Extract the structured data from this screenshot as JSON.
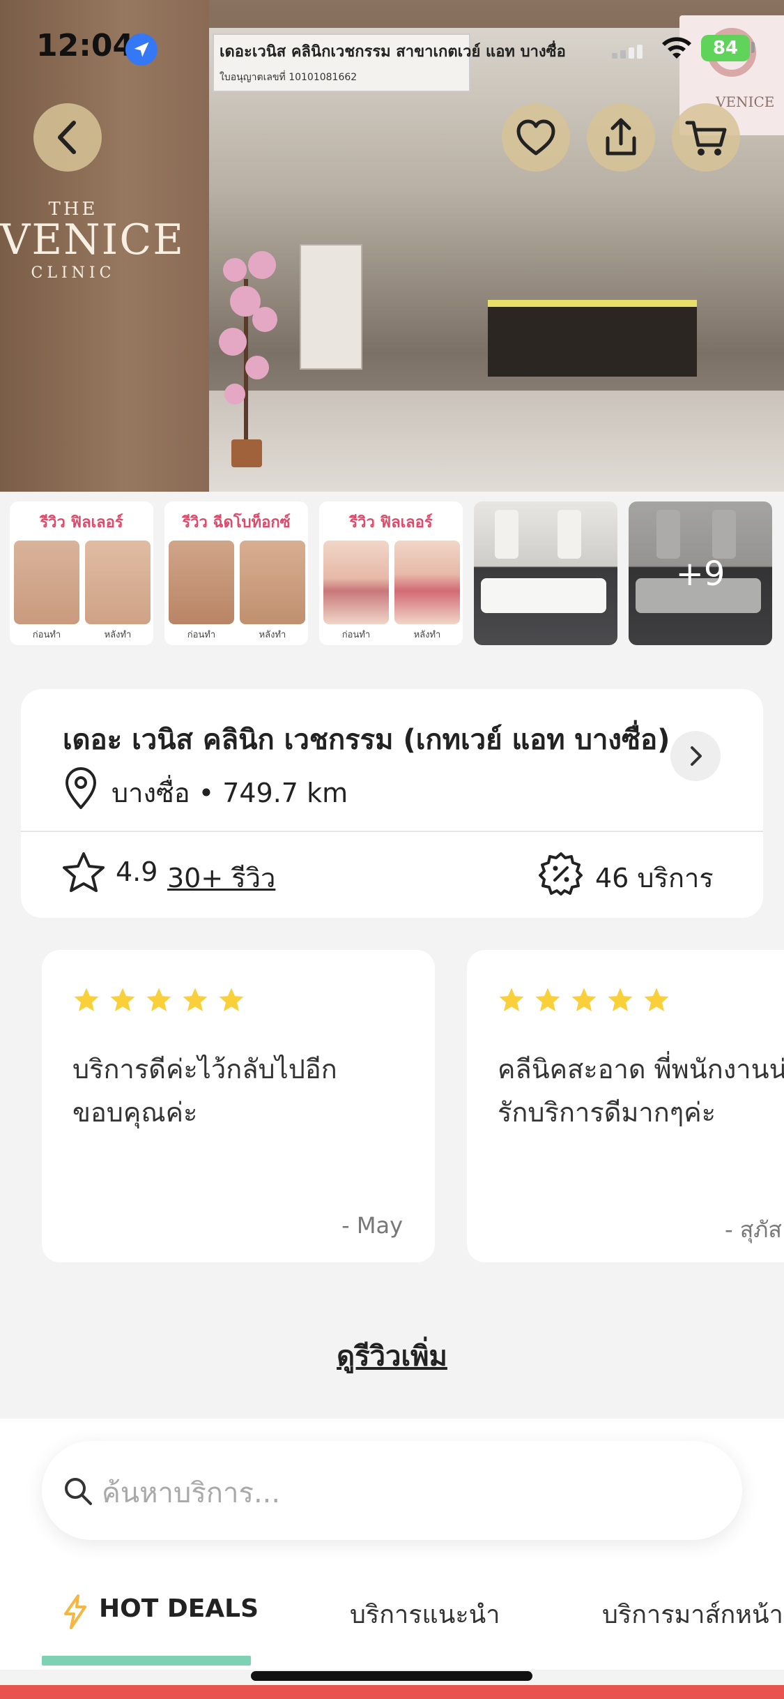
{
  "status_bar": {
    "time": "12:04",
    "battery": "84"
  },
  "hero": {
    "sign_title": "เดอะเวนิส คลินิกเวชกรรม สาขาเกตเวย์ แอท บางซื่อ",
    "sign_subtitle": "ใบอนุญาตเลขที่ 10101081662",
    "logo_the": "THE",
    "logo_venice": "VENICE",
    "logo_clinic": "CLINIC",
    "corner_logo": "VENICE"
  },
  "gallery": {
    "thumbs": [
      {
        "header": "รีวิว ฟิลเลอร์",
        "before": "ก่อนทำ",
        "after": "หลังทำ"
      },
      {
        "header": "รีวิว ฉีดโบท็อกซ์",
        "before": "ก่อนทำ",
        "after": "หลังทำ"
      },
      {
        "header": "รีวิว ฟิลเลอร์",
        "before": "ก่อนทำ",
        "after": "หลังทำ"
      }
    ],
    "more_count": "+9"
  },
  "clinic": {
    "name": "เดอะ เวนิส คลินิก เวชกรรม (เกทเวย์ แอท บางซื่อ)",
    "location": "บางซื่อ • 749.7 km",
    "rating": "4.9",
    "reviews_link": "30+ รีวิว",
    "services_count": "46 บริการ"
  },
  "reviews": [
    {
      "stars": 5,
      "text": "บริการดีค่ะไว้กลับไปอีก\nขอบคุณค่ะ",
      "author": "- May"
    },
    {
      "stars": 5,
      "text": "คลีนิคสะอาด พี่พนักงานน่า\nรักบริการดีมากๆค่ะ",
      "author": "- สุภัส"
    }
  ],
  "more_reviews_label": "ดูรีวิวเพิ่ม",
  "search": {
    "placeholder": "ค้นหาบริการ..."
  },
  "tabs": [
    {
      "label": "HOT DEALS",
      "active": true
    },
    {
      "label": "บริการแนะนำ",
      "active": false
    },
    {
      "label": "บริการมาส์กหน้า",
      "active": false
    }
  ],
  "colors": {
    "accent_tab": "#7fd1b3",
    "star": "#f9cf3a",
    "bolt": "#f5b642",
    "bottom_bar": "#e8524f",
    "battery": "#5fd35a"
  },
  "icons": {
    "back": "chevron-left-icon",
    "favorite": "heart-icon",
    "share": "share-icon",
    "cart": "cart-icon",
    "location": "map-pin-icon",
    "rating": "star-outline-icon",
    "discount": "discount-badge-icon",
    "search": "search-icon",
    "hot": "lightning-bolt-icon"
  }
}
